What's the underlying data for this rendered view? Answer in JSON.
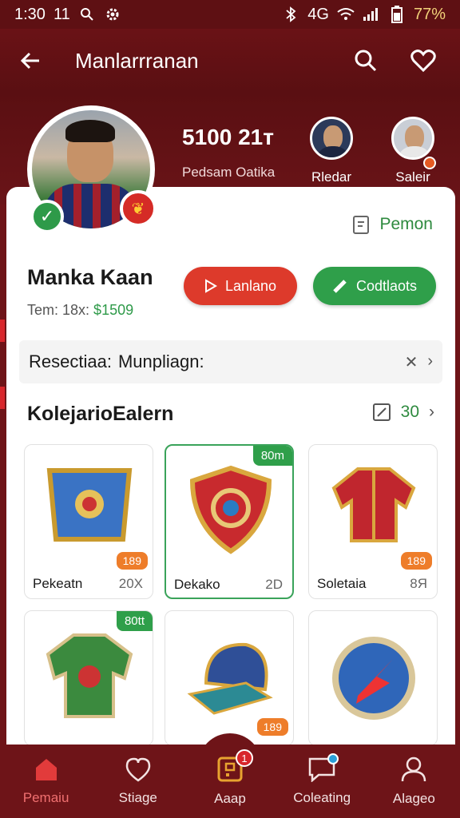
{
  "status_bar": {
    "time": "1:30",
    "extra": "11",
    "network": "4G",
    "battery": "77%"
  },
  "header": {
    "title": "Manlarrranan"
  },
  "profile": {
    "stat_value": "5100 21т",
    "stat_label": "Pedsam Oatika",
    "friends": [
      {
        "label": "Rledar"
      },
      {
        "label": "Saleir"
      }
    ],
    "name": "Manka Kaan",
    "sub_prefix": "Tem: 18x:",
    "sub_value": "1509",
    "pemon_label": "Pemon",
    "btn_primary": "Lanlano",
    "btn_secondary": "Codtlaots",
    "resec_label": "Resectiaa:",
    "resec_value": "Munpliagn:"
  },
  "section": {
    "title": "KolejarioEalern",
    "count": "30"
  },
  "items": [
    {
      "name": "Pekeatn",
      "meta": "20X",
      "count": "189",
      "tag": ""
    },
    {
      "name": "Dekako",
      "meta": "2D",
      "count": "",
      "tag": "80m"
    },
    {
      "name": "Soletaia",
      "meta": "8Я",
      "count": "189",
      "tag": ""
    },
    {
      "name": "",
      "meta": "",
      "count": "",
      "tag": "80tt"
    },
    {
      "name": "",
      "meta": "",
      "count": "189",
      "tag": ""
    },
    {
      "name": "",
      "meta": "",
      "count": "",
      "tag": ""
    }
  ],
  "nav": [
    {
      "label": "Pemaiu",
      "icon": "home-icon"
    },
    {
      "label": "Stiage",
      "icon": "heart-icon"
    },
    {
      "label": "Aaap",
      "icon": "app-icon",
      "badge": "1"
    },
    {
      "label": "Coleating",
      "icon": "chat-icon"
    },
    {
      "label": "Alageo",
      "icon": "user-icon"
    }
  ],
  "colors": {
    "brand": "#6e1418",
    "accent_red": "#dd3a2b",
    "accent_green": "#2f9f4a",
    "count_orange": "#ee7d2a"
  }
}
